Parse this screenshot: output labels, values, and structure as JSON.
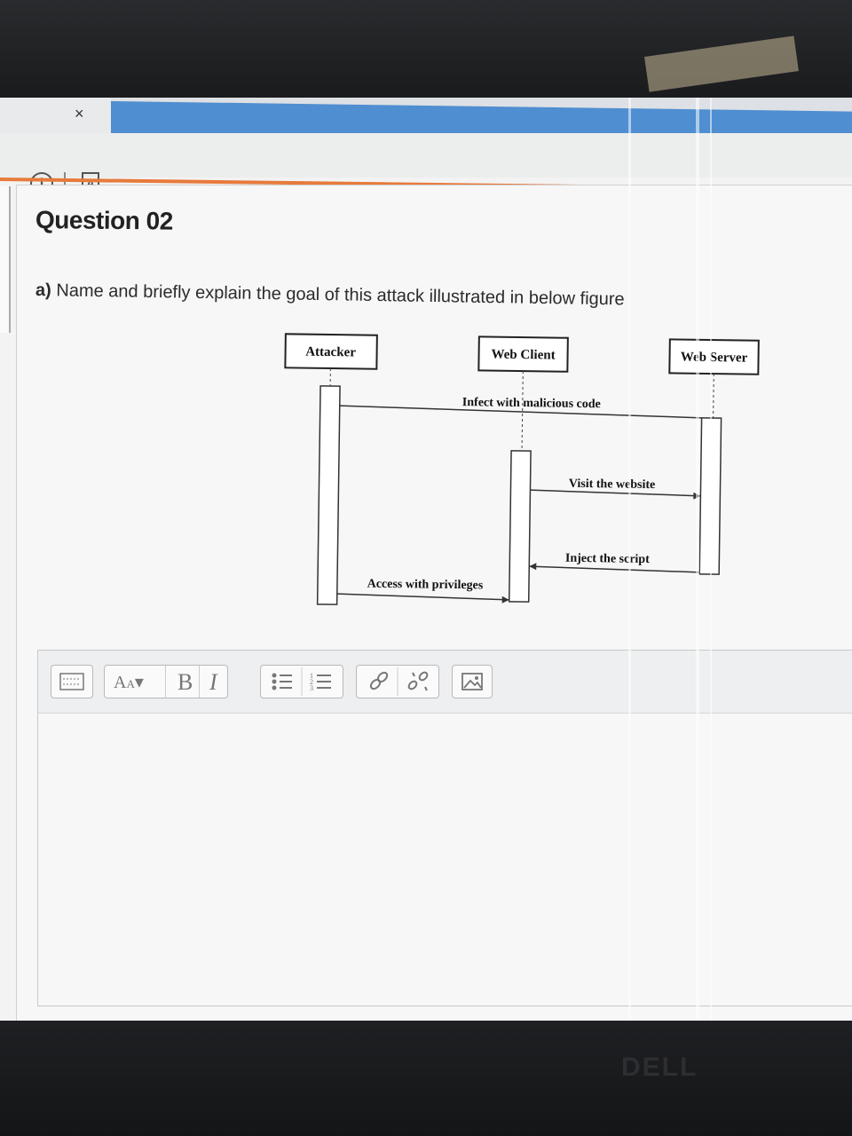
{
  "browser": {
    "tab_close": "×",
    "info_icon": "info-icon",
    "reader_icon": "A"
  },
  "question": {
    "title": "Question 02",
    "part_label": "a)",
    "prompt": "Name and briefly explain the goal of this attack illustrated in below figure"
  },
  "diagram": {
    "actors": [
      "Attacker",
      "Web Client",
      "Web Server"
    ],
    "messages": [
      {
        "label": "Infect with malicious code"
      },
      {
        "label": "Visit the website"
      },
      {
        "label": "Inject the script"
      },
      {
        "label": "Access with privileges"
      }
    ]
  },
  "editor": {
    "toolbar": {
      "font_size_label": "A",
      "bold_label": "B",
      "italic_label": "I",
      "icons": [
        "toolbar-toggle-icon",
        "font-size-icon",
        "bold-icon",
        "italic-icon",
        "bullet-list-icon",
        "numbered-list-icon",
        "link-icon",
        "unlink-icon",
        "image-icon"
      ]
    },
    "content": ""
  },
  "hardware": {
    "brand": "DELL"
  },
  "colors": {
    "tab_blue": "#4f8ed0",
    "accent_orange": "#e77a3c"
  }
}
